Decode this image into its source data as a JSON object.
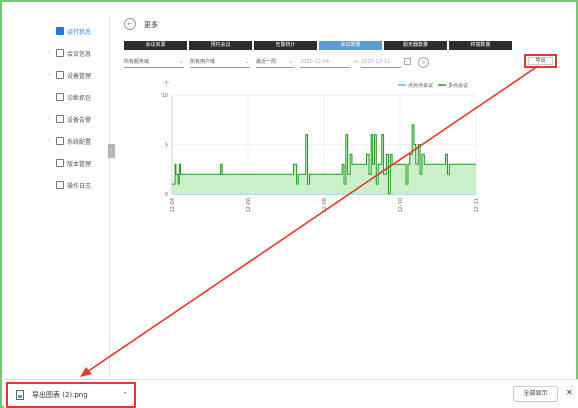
{
  "sidebar": {
    "items": [
      {
        "label": "运行状态",
        "icon": "monitor-icon",
        "expandable": false,
        "active": true
      },
      {
        "label": "会议信息",
        "icon": "document-icon",
        "expandable": true,
        "active": false
      },
      {
        "label": "设备管理",
        "icon": "device-icon",
        "expandable": true,
        "active": false
      },
      {
        "label": "诊断抓包",
        "icon": "capture-icon",
        "expandable": false,
        "active": false
      },
      {
        "label": "设备告警",
        "icon": "alert-icon",
        "expandable": true,
        "active": false
      },
      {
        "label": "系统配置",
        "icon": "gear-icon",
        "expandable": true,
        "active": false
      },
      {
        "label": "版本管理",
        "icon": "version-icon",
        "expandable": false,
        "active": false
      },
      {
        "label": "操作日志",
        "icon": "log-icon",
        "expandable": false,
        "active": false
      }
    ]
  },
  "header": {
    "title": "更多",
    "back_icon": "back-arrow-icon"
  },
  "tabs": [
    {
      "label": "会议资源",
      "active": false
    },
    {
      "label": "预约会议",
      "active": false
    },
    {
      "label": "告警统计",
      "active": false
    },
    {
      "label": "会议数量",
      "active": true
    },
    {
      "label": "服务器数量",
      "active": false
    },
    {
      "label": "终端数量",
      "active": false
    }
  ],
  "filters": {
    "domain": "所有服务域",
    "user_domain": "所有用户域",
    "range": "最近一周",
    "start_date": "2020-12-04",
    "end_date": "2020-12-11"
  },
  "export": {
    "label": "导出"
  },
  "chart_data": {
    "type": "line",
    "ylabel": "个",
    "ylim": [
      0,
      10
    ],
    "yticks": [
      "0",
      "5",
      "10"
    ],
    "xticks": [
      "12-04",
      "12-06",
      "12-08",
      "12-10",
      "12-11"
    ],
    "grid": true,
    "legend_position": "top-right",
    "series": [
      {
        "name": "点对点会议",
        "color": "#5bb5e8",
        "points": [
          [
            0,
            0
          ],
          [
            1,
            0
          ]
        ]
      },
      {
        "name": "多点会议",
        "color": "#1a9a1a",
        "fill": "#c9f0c9",
        "points": [
          [
            0.0,
            1
          ],
          [
            0.01,
            1
          ],
          [
            0.01,
            3
          ],
          [
            0.013,
            3
          ],
          [
            0.013,
            2
          ],
          [
            0.02,
            2
          ],
          [
            0.02,
            1
          ],
          [
            0.024,
            1
          ],
          [
            0.024,
            3
          ],
          [
            0.028,
            3
          ],
          [
            0.028,
            2
          ],
          [
            0.16,
            2
          ],
          [
            0.16,
            3
          ],
          [
            0.165,
            3
          ],
          [
            0.165,
            2
          ],
          [
            0.4,
            2
          ],
          [
            0.4,
            3
          ],
          [
            0.41,
            3
          ],
          [
            0.41,
            1
          ],
          [
            0.415,
            1
          ],
          [
            0.415,
            2
          ],
          [
            0.44,
            2
          ],
          [
            0.44,
            6
          ],
          [
            0.446,
            6
          ],
          [
            0.446,
            1
          ],
          [
            0.452,
            1
          ],
          [
            0.452,
            2
          ],
          [
            0.56,
            2
          ],
          [
            0.56,
            3
          ],
          [
            0.566,
            3
          ],
          [
            0.566,
            1
          ],
          [
            0.572,
            1
          ],
          [
            0.572,
            6
          ],
          [
            0.578,
            6
          ],
          [
            0.578,
            2
          ],
          [
            0.586,
            2
          ],
          [
            0.586,
            4
          ],
          [
            0.592,
            4
          ],
          [
            0.592,
            3
          ],
          [
            0.64,
            3
          ],
          [
            0.64,
            4
          ],
          [
            0.648,
            4
          ],
          [
            0.648,
            2
          ],
          [
            0.655,
            2
          ],
          [
            0.655,
            6
          ],
          [
            0.66,
            6
          ],
          [
            0.66,
            3
          ],
          [
            0.666,
            3
          ],
          [
            0.666,
            6
          ],
          [
            0.672,
            6
          ],
          [
            0.672,
            1
          ],
          [
            0.678,
            1
          ],
          [
            0.678,
            3
          ],
          [
            0.69,
            3
          ],
          [
            0.69,
            6
          ],
          [
            0.696,
            6
          ],
          [
            0.696,
            2
          ],
          [
            0.705,
            2
          ],
          [
            0.705,
            4
          ],
          [
            0.712,
            4
          ],
          [
            0.712,
            0
          ],
          [
            0.718,
            0
          ],
          [
            0.718,
            4
          ],
          [
            0.724,
            4
          ],
          [
            0.724,
            3
          ],
          [
            0.77,
            3
          ],
          [
            0.77,
            1
          ],
          [
            0.776,
            1
          ],
          [
            0.776,
            3
          ],
          [
            0.782,
            3
          ],
          [
            0.782,
            4
          ],
          [
            0.79,
            4
          ],
          [
            0.79,
            7
          ],
          [
            0.796,
            7
          ],
          [
            0.796,
            5
          ],
          [
            0.802,
            5
          ],
          [
            0.802,
            3
          ],
          [
            0.81,
            3
          ],
          [
            0.81,
            5
          ],
          [
            0.816,
            5
          ],
          [
            0.816,
            2
          ],
          [
            0.822,
            2
          ],
          [
            0.822,
            4
          ],
          [
            0.83,
            4
          ],
          [
            0.83,
            3
          ],
          [
            0.9,
            3
          ],
          [
            0.9,
            4
          ],
          [
            0.906,
            4
          ],
          [
            0.906,
            2
          ],
          [
            0.912,
            2
          ],
          [
            0.912,
            3
          ],
          [
            1.0,
            3
          ]
        ]
      }
    ]
  },
  "download_bar": {
    "file_name": "导出图表 (2).png",
    "show_all_label": "全部显示",
    "close_label": "✕"
  },
  "colors": {
    "accent": "#5b9bd5",
    "active_nav": "#1e7bd6",
    "highlight": "#e23a2a",
    "series_line": "#1a9a1a"
  }
}
